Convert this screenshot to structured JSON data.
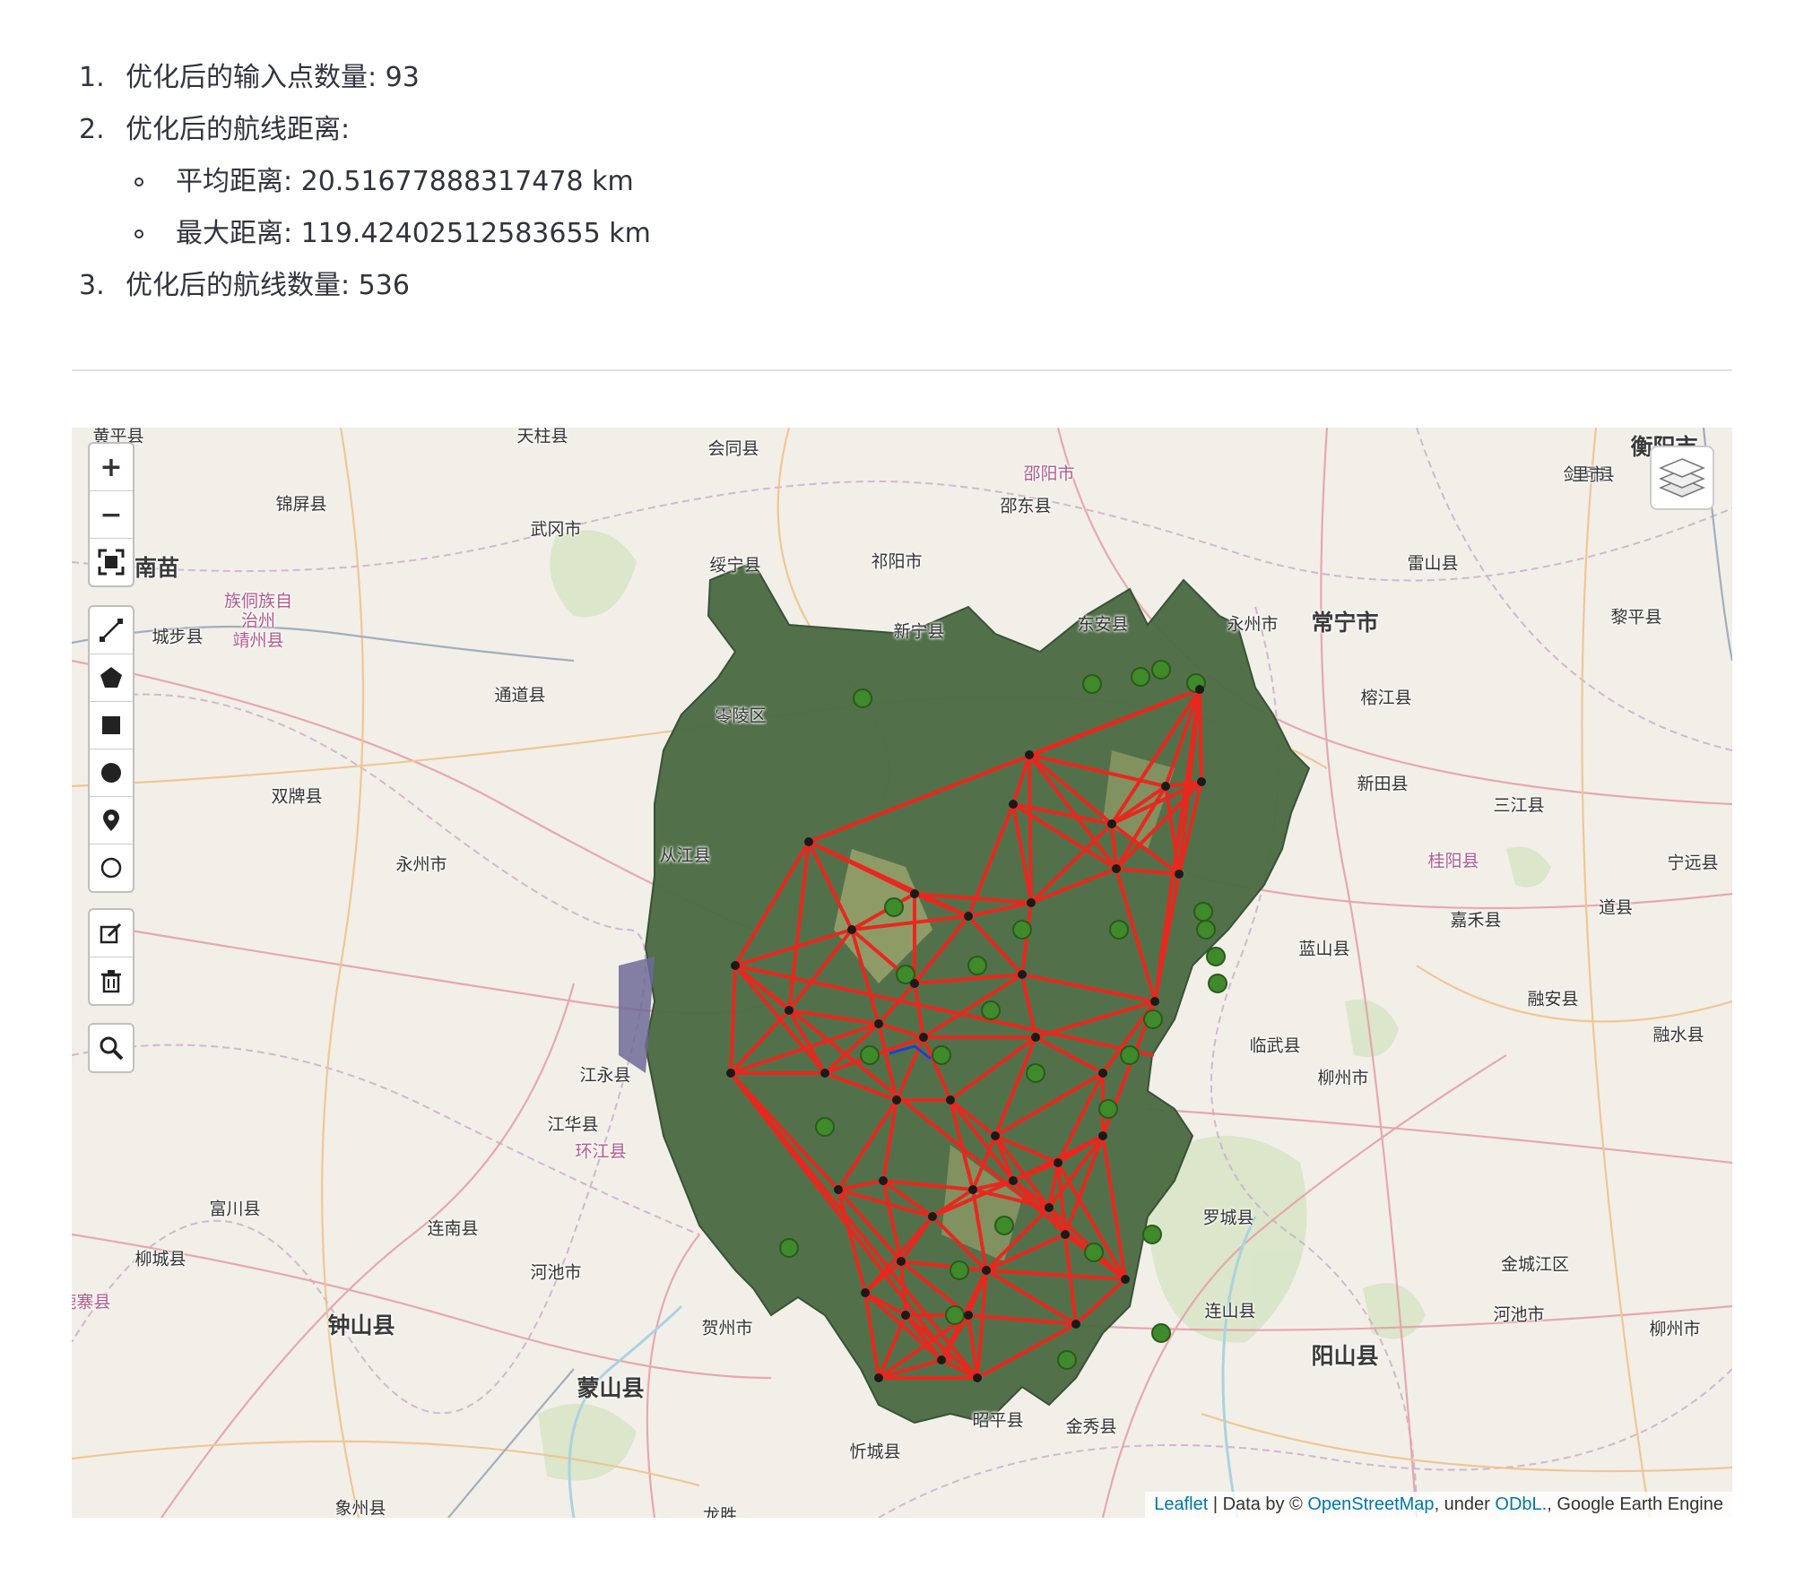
{
  "summary": {
    "item1_num": "1.",
    "item1": "优化后的输入点数量: 93",
    "item2_num": "2.",
    "item2": "优化后的航线距离:",
    "avg": "平均距离: 20.51677888317478 km",
    "max": "最大距离: 119.42402512583655 km",
    "item3_num": "3.",
    "item3": "优化后的航线数量: 536"
  },
  "map": {
    "place_labels": [
      "黄平县",
      "天柱县",
      "会同县",
      "邵阳市",
      "衡阳市",
      "剑河县",
      "锦屏县",
      "武冈市",
      "邵东县",
      "里市",
      "黔东南苗",
      "族侗族自",
      "治州",
      "靖州县",
      "绥宁县",
      "祁阳市",
      "雷山县",
      "城步县",
      "新宁县",
      "东安县",
      "永州市",
      "常宁市",
      "黎平县",
      "通道县",
      "零陵区",
      "榕江县",
      "双牌县",
      "新田县",
      "三江县",
      "从江县",
      "永州市",
      "桂阳县",
      "宁远县",
      "嘉禾县",
      "道县",
      "蓝山县",
      "融安县",
      "江永县",
      "临武县",
      "融水县",
      "江华县",
      "柳州市",
      "环江县",
      "富川县",
      "罗城县",
      "连南县",
      "金城江区",
      "柳城县",
      "河池市",
      "钟山县",
      "连山县",
      "河池市",
      "鹿寨县",
      "贺州市",
      "阳山县",
      "柳州市",
      "蒙山县",
      "昭平县",
      "金秀县",
      "忻城县",
      "象州县",
      "龙胜"
    ],
    "attribution": {
      "leaflet": "Leaflet",
      "sep1": " | Data by © ",
      "osm": "OpenStreetMap",
      "sep2": ", under ",
      "odbl": "ODbL.",
      "gee": ", Google Earth Engine"
    },
    "controls": {
      "zoom_in": "+",
      "zoom_out": "−"
    },
    "colors": {
      "route": "#e8281e",
      "region": "#4a6b42",
      "node": "#1a1a1a",
      "green_marker": "#3f8a2a"
    }
  }
}
